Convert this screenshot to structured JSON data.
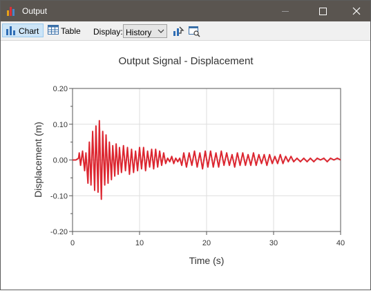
{
  "window": {
    "title": "Output",
    "controls": [
      "minimize-icon",
      "maximize-icon",
      "close-icon"
    ]
  },
  "toolbar": {
    "chart_label": "Chart",
    "table_label": "Table",
    "display_label": "Display:",
    "display_value": "History",
    "icons": [
      "export-chart-icon",
      "chart-settings-icon"
    ]
  },
  "colors": {
    "accent": "#cce4f7",
    "series": "#dc2630",
    "titlebar": "#5a5550"
  },
  "chart_data": {
    "type": "line",
    "title": "Output Signal - Displacement",
    "xlabel": "Time (s)",
    "ylabel": "Displacement (m)",
    "xlim": [
      0,
      40
    ],
    "ylim": [
      -0.2,
      0.2
    ],
    "xticks": [
      0,
      10,
      20,
      30,
      40
    ],
    "yticks": [
      -0.2,
      -0.1,
      0.0,
      0.1,
      0.2
    ],
    "xtick_labels": [
      "0",
      "10",
      "20",
      "30",
      "40"
    ],
    "ytick_labels": [
      "-0.20",
      "-0.10",
      "0.00",
      "0.10",
      "0.20"
    ],
    "grid": true,
    "series": [
      {
        "color": "#dc2630",
        "x": [
          0,
          0.5,
          0.9,
          1.0,
          1.2,
          1.5,
          1.8,
          2.0,
          2.3,
          2.5,
          2.75,
          3.0,
          3.3,
          3.5,
          3.8,
          4.0,
          4.3,
          4.5,
          4.8,
          5.0,
          5.3,
          5.5,
          5.8,
          6.0,
          6.3,
          6.5,
          6.8,
          7.0,
          7.3,
          7.6,
          7.9,
          8.2,
          8.5,
          8.8,
          9.1,
          9.4,
          9.7,
          10.0,
          10.3,
          10.6,
          10.9,
          11.2,
          11.5,
          11.8,
          12.1,
          12.4,
          12.7,
          13.0,
          13.3,
          13.6,
          13.9,
          14.2,
          14.5,
          14.8,
          15.1,
          15.4,
          15.7,
          16.0,
          16.3,
          16.6,
          17.0,
          17.4,
          17.8,
          18.2,
          18.6,
          19.0,
          19.4,
          19.8,
          20.2,
          20.6,
          21.0,
          21.4,
          21.8,
          22.2,
          22.6,
          23.0,
          23.4,
          23.8,
          24.2,
          24.6,
          25.0,
          25.4,
          25.8,
          26.2,
          26.6,
          27.0,
          27.4,
          27.8,
          28.2,
          28.6,
          29.0,
          29.4,
          29.8,
          30.2,
          30.6,
          31.0,
          31.4,
          31.8,
          32.2,
          32.6,
          33.0,
          33.5,
          34.0,
          34.5,
          35.0,
          35.5,
          36.0,
          36.5,
          37.0,
          37.5,
          38.0,
          38.5,
          39.0,
          39.5,
          40.0
        ],
        "y": [
          0,
          0,
          0.005,
          0.02,
          -0.015,
          0.025,
          -0.03,
          0.02,
          -0.065,
          0.05,
          -0.07,
          0.08,
          -0.085,
          0.095,
          -0.09,
          0.11,
          -0.11,
          0.08,
          -0.07,
          0.07,
          -0.065,
          0.05,
          -0.055,
          0.04,
          -0.045,
          0.045,
          -0.04,
          0.035,
          -0.035,
          0.04,
          -0.03,
          0.035,
          -0.04,
          0.03,
          -0.035,
          0.025,
          -0.03,
          0.035,
          -0.025,
          0.035,
          -0.03,
          0.025,
          -0.02,
          0.03,
          -0.025,
          0.03,
          -0.02,
          0.025,
          -0.015,
          0.02,
          -0.01,
          0.005,
          -0.005,
          0.01,
          -0.01,
          0.005,
          -0.005,
          0.005,
          -0.015,
          0.02,
          -0.02,
          0.02,
          -0.015,
          0.025,
          -0.02,
          0.02,
          -0.025,
          0.025,
          -0.02,
          0.025,
          -0.02,
          0.02,
          -0.02,
          0.025,
          -0.015,
          0.02,
          -0.015,
          0.015,
          -0.02,
          0.02,
          -0.015,
          0.02,
          -0.015,
          0.015,
          -0.015,
          0.02,
          -0.015,
          0.015,
          -0.01,
          0.015,
          -0.015,
          0.015,
          -0.01,
          0.01,
          -0.01,
          0.015,
          -0.01,
          0.01,
          -0.005,
          0.01,
          -0.005,
          0.005,
          -0.005,
          0.005,
          -0.005,
          0.005,
          -0.005,
          0.005,
          0,
          0.005,
          -0.005,
          0.005,
          0,
          0.005,
          0
        ]
      }
    ]
  }
}
